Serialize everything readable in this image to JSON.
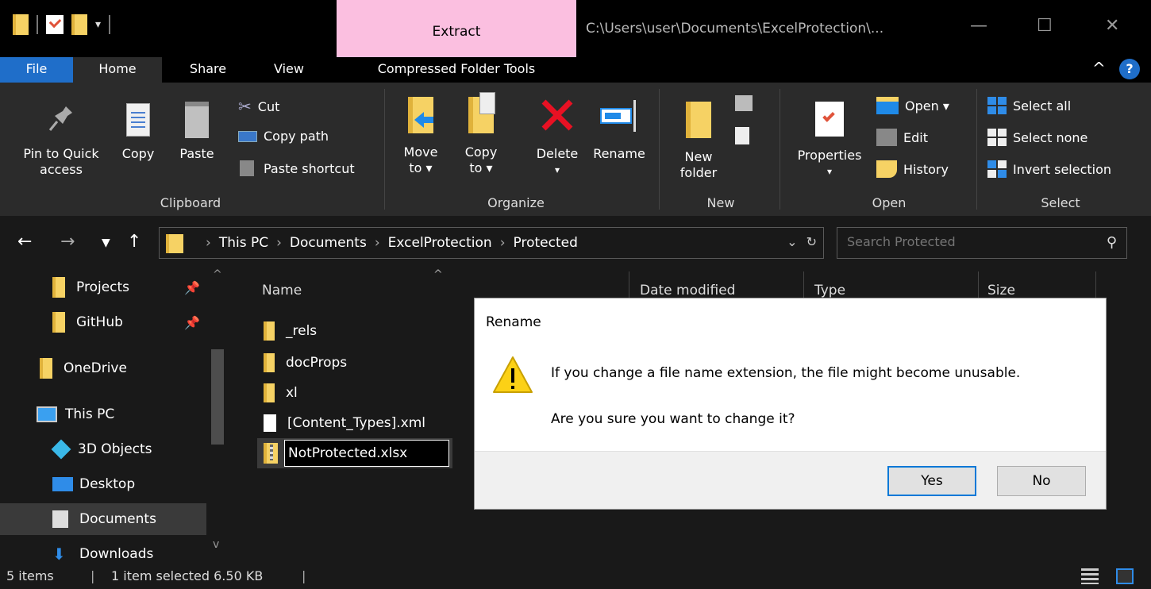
{
  "titlebar": {
    "context_tab": "Extract",
    "path": "C:\\Users\\user\\Documents\\ExcelProtection\\...",
    "minimize": "—",
    "maximize": "☐",
    "close": "✕"
  },
  "tabs": {
    "file": "File",
    "home": "Home",
    "share": "Share",
    "view": "View",
    "compressed": "Compressed Folder Tools"
  },
  "ribbon": {
    "pin_l1": "Pin to Quick",
    "pin_l2": "access",
    "copy": "Copy",
    "paste": "Paste",
    "cut": "Cut",
    "copy_path": "Copy path",
    "paste_shortcut": "Paste shortcut",
    "clipboard": "Clipboard",
    "move_l1": "Move",
    "move_l2": "to ▾",
    "copyto_l1": "Copy",
    "copyto_l2": "to ▾",
    "delete": "Delete",
    "delete_arrow": "▾",
    "rename": "Rename",
    "organize": "Organize",
    "newfolder_l1": "New",
    "newfolder_l2": "folder",
    "new": "New",
    "properties": "Properties",
    "properties_arrow": "▾",
    "open_btn": "Open ▾",
    "edit": "Edit",
    "history": "History",
    "open": "Open",
    "select_all": "Select all",
    "select_none": "Select none",
    "invert": "Invert selection",
    "select": "Select"
  },
  "address": {
    "crumbs": [
      "This PC",
      "Documents",
      "ExcelProtection",
      "Protected"
    ],
    "search_placeholder": "Search Protected"
  },
  "nav": {
    "items": [
      "Projects",
      "GitHub",
      "OneDrive",
      "This PC",
      "3D Objects",
      "Desktop",
      "Documents",
      "Downloads"
    ]
  },
  "files": {
    "columns": [
      "Name",
      "Date modified",
      "Type",
      "Size"
    ],
    "rows": [
      "_rels",
      "docProps",
      "xl",
      "[Content_Types].xml"
    ],
    "rename_value": "NotProtected.xlsx"
  },
  "status": {
    "count": "5 items",
    "selected": "1 item selected  6.50 KB"
  },
  "dialog": {
    "title": "Rename",
    "message1": "If you change a file name extension, the file might become unusable.",
    "message2": "Are you sure you want to change it?",
    "yes": "Yes",
    "no": "No"
  },
  "colors": {
    "accent": "#1f6ec9",
    "context_tab": "#fbbfe0",
    "folder": "#f6d264",
    "delete_red": "#e81123",
    "warning": "#fcd116"
  }
}
